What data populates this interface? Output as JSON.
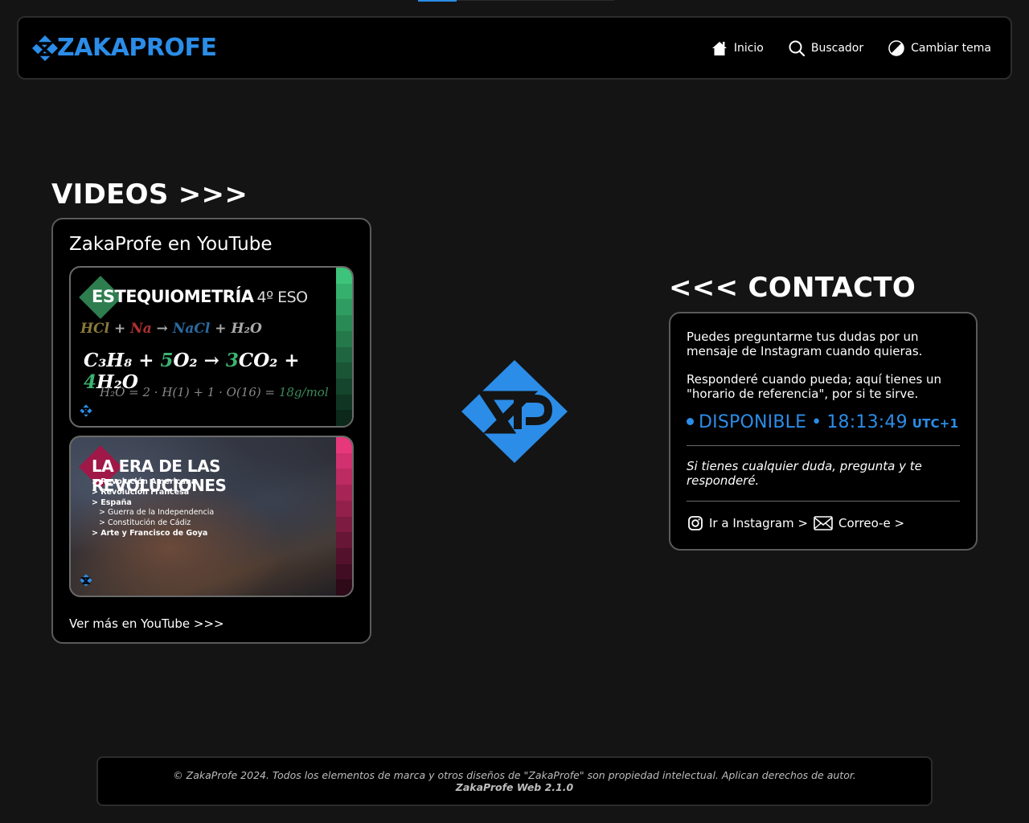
{
  "header": {
    "logo_text": "ZAKAPROFE",
    "nav": [
      {
        "label": "Inicio",
        "icon": "home-icon"
      },
      {
        "label": "Buscador",
        "icon": "search-icon"
      },
      {
        "label": "Cambiar tema",
        "icon": "theme-toggle-icon"
      }
    ]
  },
  "videos": {
    "heading": "VIDEOS >>>",
    "card_title": "ZakaProfe en YouTube",
    "more_link": "Ver más en YouTube >>>",
    "thumbs": [
      {
        "title": "ESTEQUIOMETRÍA",
        "subtitle": "4º ESO",
        "accent": "#2e7d4f"
      },
      {
        "title": "LA ERA DE LAS REVOLUCIONES",
        "accent": "#c2185b",
        "items": [
          "> Revolución Americana",
          "> Revolución Francesa",
          "> España",
          "> Guerra de la Independencia",
          "> Constitución de Cádiz",
          "> Arte y Francisco de Goya"
        ]
      }
    ]
  },
  "contact": {
    "heading": "<<< CONTACTO",
    "text1": "Puedes preguntarme tus dudas por un mensaje de Instagram cuando quieras.",
    "text2": "Responderé cuando pueda; aquí tienes un \"horario de referencia\", por si te sirve.",
    "status_label": "DISPONIBLE",
    "status_sep": "•",
    "time": "18:13:49",
    "timezone": "UTC+1",
    "note": "Si tienes cualquier duda, pregunta y te responderé.",
    "instagram_link": "Ir a Instagram >",
    "email_link": "Correo-e >"
  },
  "footer": {
    "copyright": "© ZakaProfe 2024. Todos los elementos de marca y otros diseños de \"ZakaProfe\" son propiedad intelectual. Aplican derechos de autor.",
    "version": "ZakaProfe Web 2.1.0"
  },
  "colors": {
    "brand": "#2b8de8",
    "background": "#141414",
    "card": "#000000"
  }
}
